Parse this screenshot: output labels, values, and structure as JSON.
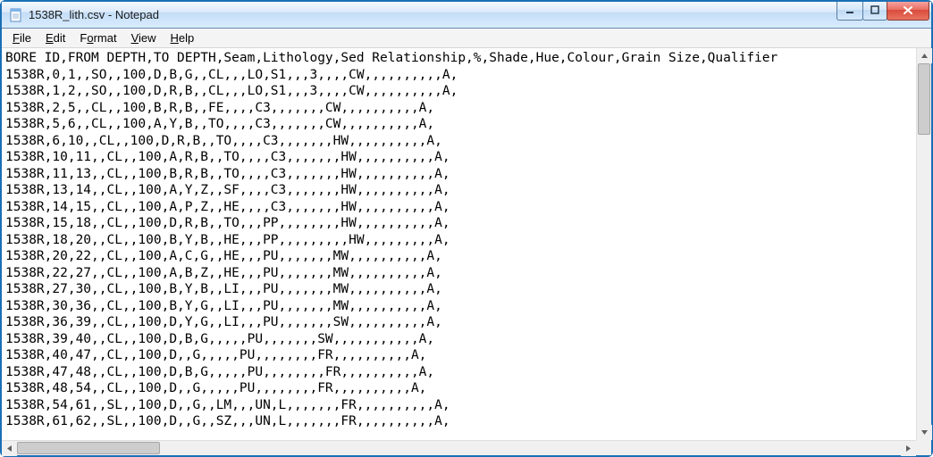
{
  "window": {
    "title": "1538R_lith.csv - Notepad"
  },
  "menu": {
    "file": {
      "prefix": "",
      "ul": "F",
      "rest": "ile"
    },
    "edit": {
      "prefix": "",
      "ul": "E",
      "rest": "dit"
    },
    "format": {
      "prefix": "F",
      "ul": "o",
      "rest": "rmat"
    },
    "view": {
      "prefix": "",
      "ul": "V",
      "rest": "iew"
    },
    "help": {
      "prefix": "",
      "ul": "H",
      "rest": "elp"
    }
  },
  "file_lines": [
    "BORE ID,FROM DEPTH,TO DEPTH,Seam,Lithology,Sed Relationship,%,Shade,Hue,Colour,Grain Size,Qualifier",
    "1538R,0,1,,SO,,100,D,B,G,,CL,,,LO,S1,,,3,,,,CW,,,,,,,,,,A,",
    "1538R,1,2,,SO,,100,D,R,B,,CL,,,LO,S1,,,3,,,,CW,,,,,,,,,,A,",
    "1538R,2,5,,CL,,100,B,R,B,,FE,,,,C3,,,,,,,CW,,,,,,,,,,A,",
    "1538R,5,6,,CL,,100,A,Y,B,,TO,,,,C3,,,,,,,CW,,,,,,,,,,A,",
    "1538R,6,10,,CL,,100,D,R,B,,TO,,,,C3,,,,,,,HW,,,,,,,,,,A,",
    "1538R,10,11,,CL,,100,A,R,B,,TO,,,,C3,,,,,,,HW,,,,,,,,,,A,",
    "1538R,11,13,,CL,,100,B,R,B,,TO,,,,C3,,,,,,,HW,,,,,,,,,,A,",
    "1538R,13,14,,CL,,100,A,Y,Z,,SF,,,,C3,,,,,,,HW,,,,,,,,,,A,",
    "1538R,14,15,,CL,,100,A,P,Z,,HE,,,,C3,,,,,,,HW,,,,,,,,,,A,",
    "1538R,15,18,,CL,,100,D,R,B,,TO,,,PP,,,,,,,,HW,,,,,,,,,,A,",
    "1538R,18,20,,CL,,100,B,Y,B,,HE,,,PP,,,,,,,,,HW,,,,,,,,,A,",
    "1538R,20,22,,CL,,100,A,C,G,,HE,,,PU,,,,,,,MW,,,,,,,,,,A,",
    "1538R,22,27,,CL,,100,A,B,Z,,HE,,,PU,,,,,,,MW,,,,,,,,,,A,",
    "1538R,27,30,,CL,,100,B,Y,B,,LI,,,PU,,,,,,,MW,,,,,,,,,,A,",
    "1538R,30,36,,CL,,100,B,Y,G,,LI,,,PU,,,,,,,MW,,,,,,,,,,A,",
    "1538R,36,39,,CL,,100,D,Y,G,,LI,,,PU,,,,,,,SW,,,,,,,,,,A,",
    "1538R,39,40,,CL,,100,D,B,G,,,,,PU,,,,,,,SW,,,,,,,,,,,A,",
    "1538R,40,47,,CL,,100,D,,G,,,,,PU,,,,,,,,FR,,,,,,,,,,A,",
    "1538R,47,48,,CL,,100,D,B,G,,,,,PU,,,,,,,,FR,,,,,,,,,,A,",
    "1538R,48,54,,CL,,100,D,,G,,,,,PU,,,,,,,,FR,,,,,,,,,,A,",
    "1538R,54,61,,SL,,100,D,,G,,LM,,,UN,L,,,,,,,FR,,,,,,,,,,A,",
    "1538R,61,62,,SL,,100,D,,G,,SZ,,,UN,L,,,,,,,FR,,,,,,,,,,A,"
  ]
}
